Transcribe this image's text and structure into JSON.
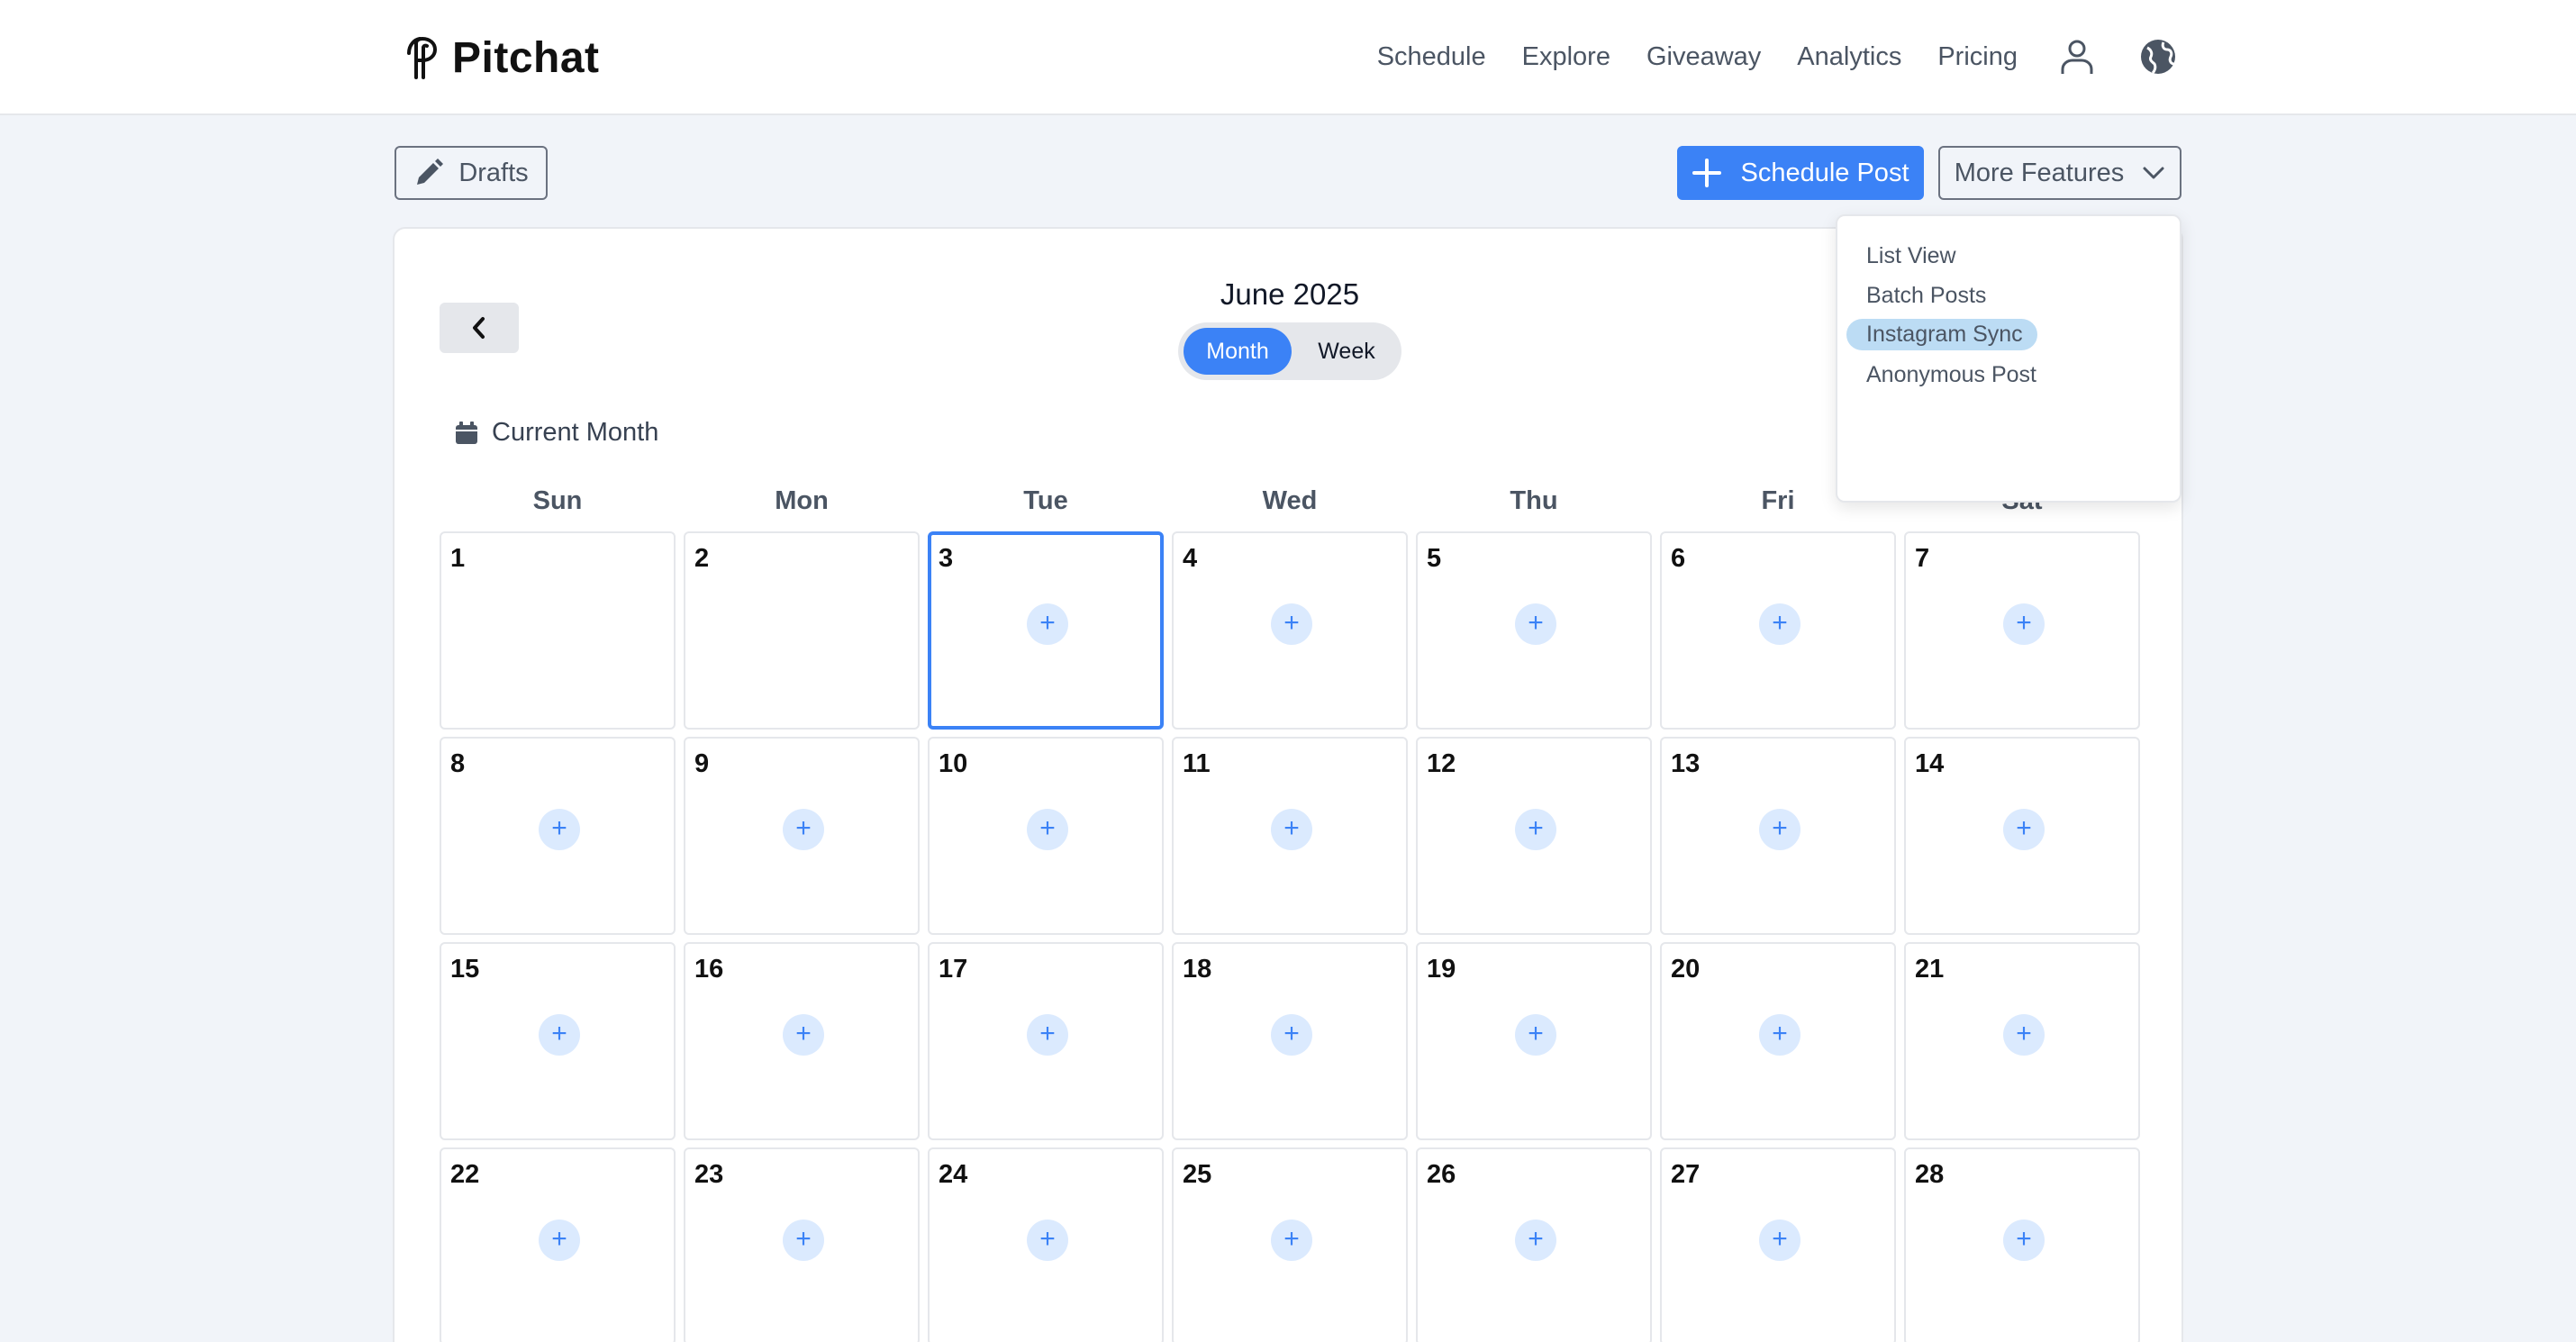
{
  "header": {
    "brand": "Pitchat",
    "nav": [
      "Schedule",
      "Explore",
      "Giveaway",
      "Analytics",
      "Pricing"
    ],
    "icons": [
      "user-icon",
      "globe-icon"
    ]
  },
  "toolbar": {
    "drafts_label": "Drafts",
    "schedule_label": "Schedule Post",
    "more_label": "More Features"
  },
  "dropdown": {
    "items": [
      "List View",
      "Batch Posts",
      "Instagram Sync",
      "Anonymous Post"
    ],
    "highlighted_index": 2
  },
  "calendar": {
    "title": "June 2025",
    "views": [
      "Month",
      "Week"
    ],
    "active_view": "Month",
    "current_month_label": "Current Month",
    "weekdays": [
      "Sun",
      "Mon",
      "Tue",
      "Wed",
      "Thu",
      "Fri",
      "Sat"
    ],
    "today": 3,
    "weeks": [
      [
        1,
        2,
        3,
        4,
        5,
        6,
        7
      ],
      [
        8,
        9,
        10,
        11,
        12,
        13,
        14
      ],
      [
        15,
        16,
        17,
        18,
        19,
        20,
        21
      ],
      [
        22,
        23,
        24,
        25,
        26,
        27,
        28
      ]
    ],
    "days_without_add": [
      1,
      2
    ],
    "add_symbol": "+"
  }
}
